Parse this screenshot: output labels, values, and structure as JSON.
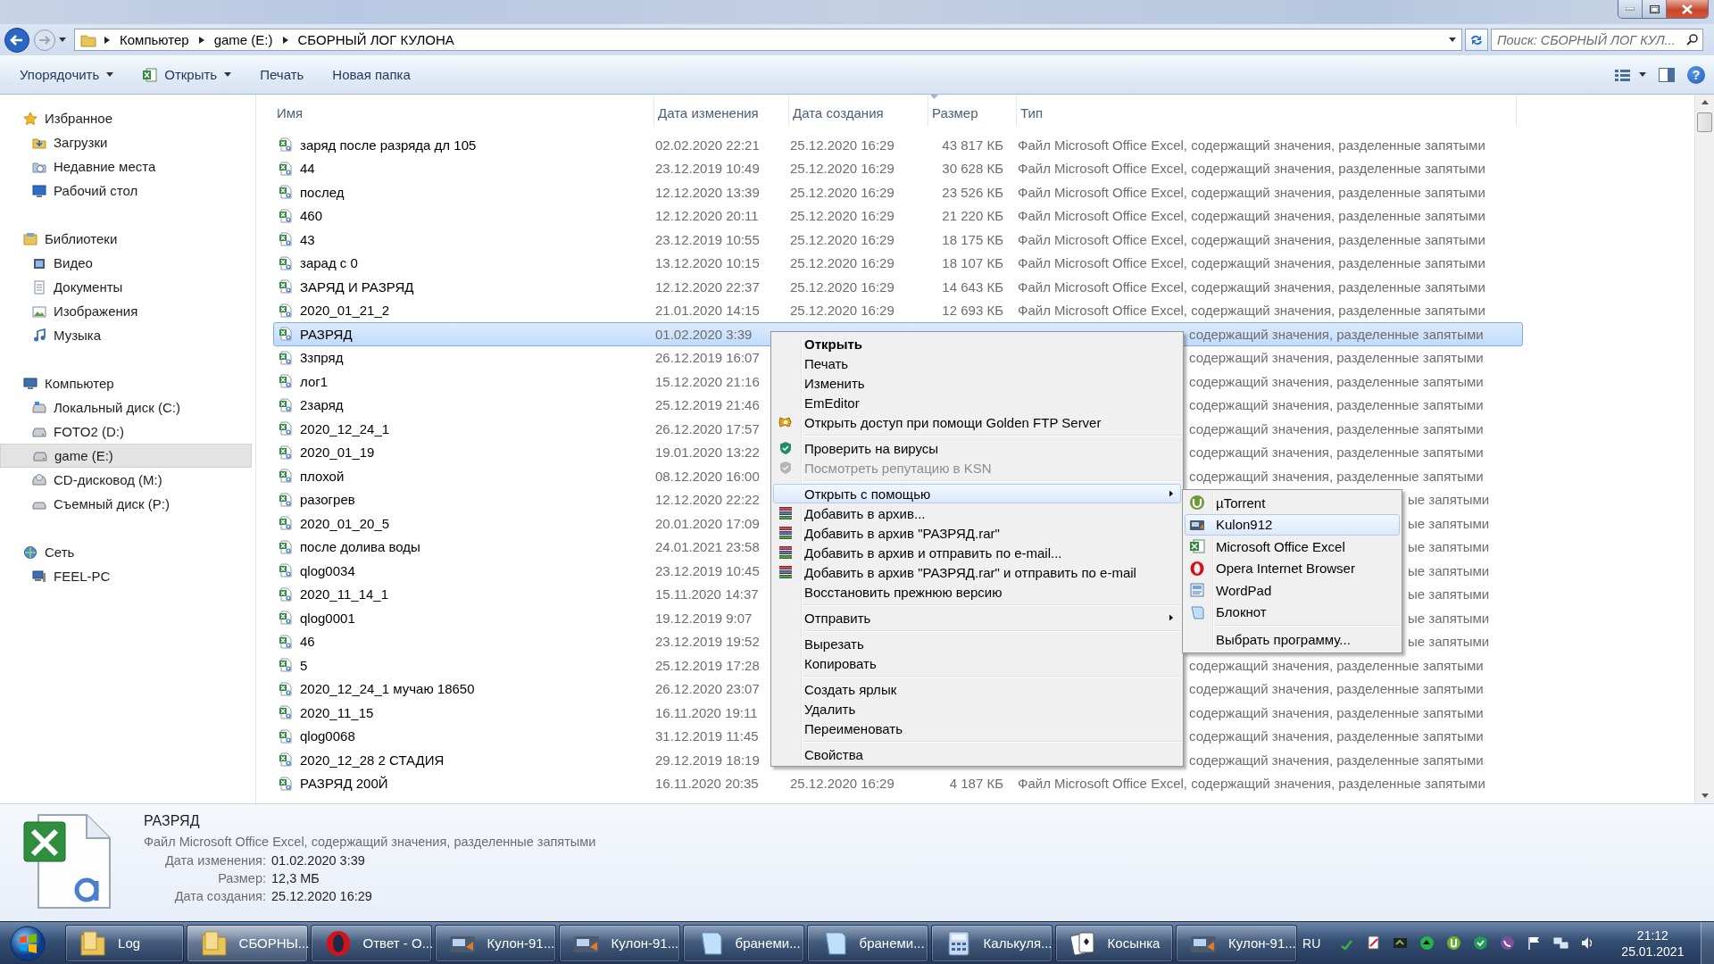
{
  "address_bar": {
    "path": [
      "Компьютер",
      "game (E:)",
      "СБОРНЫЙ ЛОГ КУЛОНА"
    ],
    "search": {
      "placeholder": "Поиск: СБОРНЫЙ ЛОГ КУЛ..."
    }
  },
  "toolbar": {
    "items": [
      {
        "label": "Упорядочить",
        "dropdown": true
      },
      {
        "label": "Открыть",
        "dropdown": true
      },
      {
        "label": "Печать",
        "dropdown": false
      },
      {
        "label": "Новая папка",
        "dropdown": false
      }
    ],
    "help": "?"
  },
  "navigation": [
    {
      "label": "Избранное",
      "selected": false,
      "children": [
        {
          "label": "Загрузки",
          "selected": false
        },
        {
          "label": "Недавние места",
          "selected": false
        },
        {
          "label": "Рабочий стол",
          "selected": false
        }
      ]
    },
    {
      "label": "Библиотеки",
      "selected": false,
      "children": [
        {
          "label": "Видео",
          "selected": false
        },
        {
          "label": "Документы",
          "selected": false
        },
        {
          "label": "Изображения",
          "selected": false
        },
        {
          "label": "Музыка",
          "selected": false
        }
      ]
    },
    {
      "label": "Компьютер",
      "selected": false,
      "children": [
        {
          "label": "Локальный диск (C:)",
          "selected": false
        },
        {
          "label": "FOTO2 (D:)",
          "selected": false
        },
        {
          "label": "game (E:)",
          "selected": true
        },
        {
          "label": "CD-дисковод (M:)",
          "selected": false
        },
        {
          "label": "Съемный диск (P:)",
          "selected": false
        }
      ]
    },
    {
      "label": "Сеть",
      "selected": false,
      "children": [
        {
          "label": "FEEL-PC",
          "selected": false
        }
      ]
    }
  ],
  "file_list": {
    "columns": [
      "Имя",
      "Дата изменения",
      "Дата создания",
      "Размер",
      "Тип"
    ],
    "rows": [
      {
        "kind": "full",
        "name": "заряд после разряда дл 105",
        "modified": "02.02.2020 22:21",
        "created": "25.12.2020 16:29",
        "size": "43 817 КБ",
        "type": "Файл Microsoft Office Excel, содержащий значения, разделенные запятыми",
        "selected": false
      },
      {
        "kind": "full",
        "name": "44",
        "modified": "23.12.2019 10:49",
        "created": "25.12.2020 16:29",
        "size": "30 628 КБ",
        "type": "Файл Microsoft Office Excel, содержащий значения, разделенные запятыми",
        "selected": false
      },
      {
        "kind": "full",
        "name": "послед",
        "modified": "12.12.2020 13:39",
        "created": "25.12.2020 16:29",
        "size": "23 526 КБ",
        "type": "Файл Microsoft Office Excel, содержащий значения, разделенные запятыми",
        "selected": false
      },
      {
        "kind": "full",
        "name": "460",
        "modified": "12.12.2020 20:11",
        "created": "25.12.2020 16:29",
        "size": "21 220 КБ",
        "type": "Файл Microsoft Office Excel, содержащий значения, разделенные запятыми",
        "selected": false
      },
      {
        "kind": "full",
        "name": "43",
        "modified": "23.12.2019 10:55",
        "created": "25.12.2020 16:29",
        "size": "18 175 КБ",
        "type": "Файл Microsoft Office Excel, содержащий значения, разделенные запятыми",
        "selected": false
      },
      {
        "kind": "full",
        "name": "зарад с 0",
        "modified": "13.12.2020 10:15",
        "created": "25.12.2020 16:29",
        "size": "18 107 КБ",
        "type": "Файл Microsoft Office Excel, содержащий значения, разделенные запятыми",
        "selected": false
      },
      {
        "kind": "full",
        "name": "ЗАРЯД И РАЗРЯД",
        "modified": "12.12.2020 22:37",
        "created": "25.12.2020 16:29",
        "size": "14 643 КБ",
        "type": "Файл Microsoft Office Excel, содержащий значения, разделенные запятыми",
        "selected": false
      },
      {
        "kind": "full",
        "name": "2020_01_21_2",
        "modified": "21.01.2020 14:15",
        "created": "25.12.2020 16:29",
        "size": "12 693 КБ",
        "type": "Файл Microsoft Office Excel, содержащий значения, разделенные запятыми",
        "selected": false
      },
      {
        "kind": "behind_menu",
        "name": "РАЗРЯД",
        "modified": "01.02.2020 3:39",
        "type": "содержащий значения, разделенные запятыми",
        "selected": true
      },
      {
        "kind": "behind_menu",
        "name": "3зпряд",
        "modified": "26.12.2019 16:07",
        "type": "содержащий значения, разделенные запятыми",
        "selected": false
      },
      {
        "kind": "behind_menu",
        "name": "лог1",
        "modified": "15.12.2020 21:16",
        "type": "содержащий значения, разделенные запятыми",
        "selected": false
      },
      {
        "kind": "behind_menu",
        "name": "2заряд",
        "modified": "25.12.2019 21:46",
        "type": "содержащий значения, разделенные запятыми",
        "selected": false
      },
      {
        "kind": "behind_menu",
        "name": "2020_12_24_1",
        "modified": "26.12.2020 17:57",
        "type": "содержащий значения, разделенные запятыми",
        "selected": false
      },
      {
        "kind": "behind_menu",
        "name": "2020_01_19",
        "modified": "19.01.2020 13:22",
        "type": "содержащий значения, разделенные запятыми",
        "selected": false
      },
      {
        "kind": "behind_menu",
        "name": "плохой",
        "modified": "08.12.2020 16:00",
        "type": "содержащий значения, разделенные запятыми",
        "selected": false
      },
      {
        "kind": "behind_submenu",
        "name": "разогрев",
        "modified": "12.12.2020 22:22",
        "type": "ые запятыми",
        "selected": false
      },
      {
        "kind": "behind_submenu",
        "name": "2020_01_20_5",
        "modified": "20.01.2020 17:09",
        "type": "ые запятыми",
        "selected": false
      },
      {
        "kind": "behind_submenu",
        "name": "после долива воды",
        "modified": "24.01.2021 23:58",
        "type": "ые запятыми",
        "selected": false
      },
      {
        "kind": "behind_submenu",
        "name": "qlog0034",
        "modified": "23.12.2019 10:45",
        "type": "ые запятыми",
        "selected": false
      },
      {
        "kind": "behind_submenu",
        "name": "2020_11_14_1",
        "modified": "15.11.2020 14:37",
        "type": "ые запятыми",
        "selected": false
      },
      {
        "kind": "behind_submenu",
        "name": "qlog0001",
        "modified": "19.12.2019 9:07",
        "type": "ые запятыми",
        "selected": false
      },
      {
        "kind": "behind_submenu",
        "name": "46",
        "modified": "23.12.2019 19:52",
        "type": "ые запятыми",
        "selected": false
      },
      {
        "kind": "behind_menu",
        "name": "5",
        "modified": "25.12.2019 17:28",
        "type": "содержащий значения, разделенные запятыми",
        "selected": false
      },
      {
        "kind": "behind_menu",
        "name": "2020_12_24_1 мучаю 18650",
        "modified": "26.12.2020 23:07",
        "type": "содержащий значения, разделенные запятыми",
        "selected": false
      },
      {
        "kind": "behind_menu",
        "name": "2020_11_15",
        "modified": "16.11.2020 19:11",
        "type": "содержащий значения, разделенные запятыми",
        "selected": false
      },
      {
        "kind": "behind_menu",
        "name": "qlog0068",
        "modified": "31.12.2019 11:45",
        "type": "содержащий значения, разделенные запятыми",
        "selected": false
      },
      {
        "kind": "behind_menu",
        "name": "2020_12_28 2 СТАДИЯ",
        "modified": "29.12.2019 18:19",
        "type": "содержащий значения, разделенные запятыми",
        "selected": false
      },
      {
        "kind": "full",
        "name": "РАЗРЯД 200Й",
        "modified": "16.11.2020 20:35",
        "created": "25.12.2020 16:29",
        "size": "4 187 КБ",
        "type": "Файл Microsoft Office Excel, содержащий значения, разделенные запятыми",
        "selected": false
      }
    ]
  },
  "context_menu": {
    "groups": [
      [
        {
          "label": "Открыть",
          "kind": "default",
          "disabled": false,
          "selected": false,
          "submenu": false
        },
        {
          "label": "Печать",
          "kind": "normal",
          "disabled": false,
          "selected": false,
          "submenu": false
        },
        {
          "label": "Изменить",
          "kind": "normal",
          "disabled": false,
          "selected": false,
          "submenu": false
        },
        {
          "label": "EmEditor",
          "kind": "normal",
          "disabled": false,
          "selected": false,
          "submenu": false
        },
        {
          "label": "Открыть доступ при помощи Golden FTP Server",
          "kind": "normal",
          "disabled": false,
          "selected": false,
          "submenu": false
        }
      ],
      [
        {
          "label": "Проверить на вирусы",
          "kind": "normal",
          "disabled": false,
          "selected": false,
          "submenu": false
        },
        {
          "label": "Посмотреть репутацию в KSN",
          "kind": "normal",
          "disabled": true,
          "selected": false,
          "submenu": false
        }
      ],
      [
        {
          "label": "Открыть с помощью",
          "kind": "normal",
          "disabled": false,
          "selected": true,
          "submenu": true
        },
        {
          "label": "Добавить в архив...",
          "kind": "normal",
          "disabled": false,
          "selected": false,
          "submenu": false
        },
        {
          "label": "Добавить в архив \"РАЗРЯД.rar\"",
          "kind": "normal",
          "disabled": false,
          "selected": false,
          "submenu": false
        },
        {
          "label": "Добавить в архив и отправить по e-mail...",
          "kind": "normal",
          "disabled": false,
          "selected": false,
          "submenu": false
        },
        {
          "label": "Добавить в архив \"РАЗРЯД.rar\" и отправить по e-mail",
          "kind": "normal",
          "disabled": false,
          "selected": false,
          "submenu": false
        },
        {
          "label": "Восстановить прежнюю версию",
          "kind": "normal",
          "disabled": false,
          "selected": false,
          "submenu": false
        }
      ],
      [
        {
          "label": "Отправить",
          "kind": "normal",
          "disabled": false,
          "selected": false,
          "submenu": true
        }
      ],
      [
        {
          "label": "Вырезать",
          "kind": "normal",
          "disabled": false,
          "selected": false,
          "submenu": false
        },
        {
          "label": "Копировать",
          "kind": "normal",
          "disabled": false,
          "selected": false,
          "submenu": false
        }
      ],
      [
        {
          "label": "Создать ярлык",
          "kind": "normal",
          "disabled": false,
          "selected": false,
          "submenu": false
        },
        {
          "label": "Удалить",
          "kind": "normal",
          "disabled": false,
          "selected": false,
          "submenu": false
        },
        {
          "label": "Переименовать",
          "kind": "normal",
          "disabled": false,
          "selected": false,
          "submenu": false
        }
      ],
      [
        {
          "label": "Свойства",
          "kind": "normal",
          "disabled": false,
          "selected": false,
          "submenu": false
        }
      ]
    ]
  },
  "open_with_menu": {
    "items": [
      {
        "label": "µTorrent",
        "selected": false
      },
      {
        "label": "Kulon912",
        "selected": true
      },
      {
        "label": "Microsoft Office Excel",
        "selected": false
      },
      {
        "label": "Opera Internet Browser",
        "selected": false
      },
      {
        "label": "WordPad",
        "selected": false
      },
      {
        "label": "Блокнот",
        "selected": false
      }
    ],
    "more": "Выбрать программу..."
  },
  "details_pane": {
    "name": "РАЗРЯД",
    "type": "Файл Microsoft Office Excel, содержащий значения, разделенные запятыми",
    "fields": [
      {
        "label": "Дата изменения:",
        "value": "01.02.2020 3:39"
      },
      {
        "label": "Размер:",
        "value": "12,3 МБ"
      },
      {
        "label": "Дата создания:",
        "value": "25.12.2020 16:29"
      }
    ]
  },
  "taskbar": {
    "buttons": [
      {
        "label": "Log",
        "selected": false
      },
      {
        "label": "СБОРНЫ...",
        "selected": true
      },
      {
        "label": "Ответ - О...",
        "selected": false
      },
      {
        "label": "Кулон-91...",
        "selected": false
      },
      {
        "label": "Кулон-91...",
        "selected": false
      },
      {
        "label": "бранеми...",
        "selected": false
      },
      {
        "label": "бранеми...",
        "selected": false
      },
      {
        "label": "Калькуля...",
        "selected": false
      },
      {
        "label": "Косынка",
        "selected": false
      },
      {
        "label": "Кулон-91...",
        "selected": false
      }
    ],
    "language": "RU",
    "time": "21:12",
    "date": "25.01.2021"
  }
}
